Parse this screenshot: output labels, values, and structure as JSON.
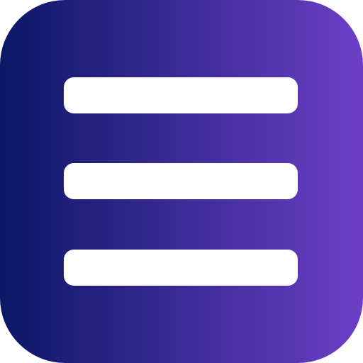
{
  "icon": {
    "name": "hamburger-menu-icon",
    "gradient_start": "#0b1766",
    "gradient_end": "#6c3fc6",
    "bar_color": "#ffffff"
  }
}
